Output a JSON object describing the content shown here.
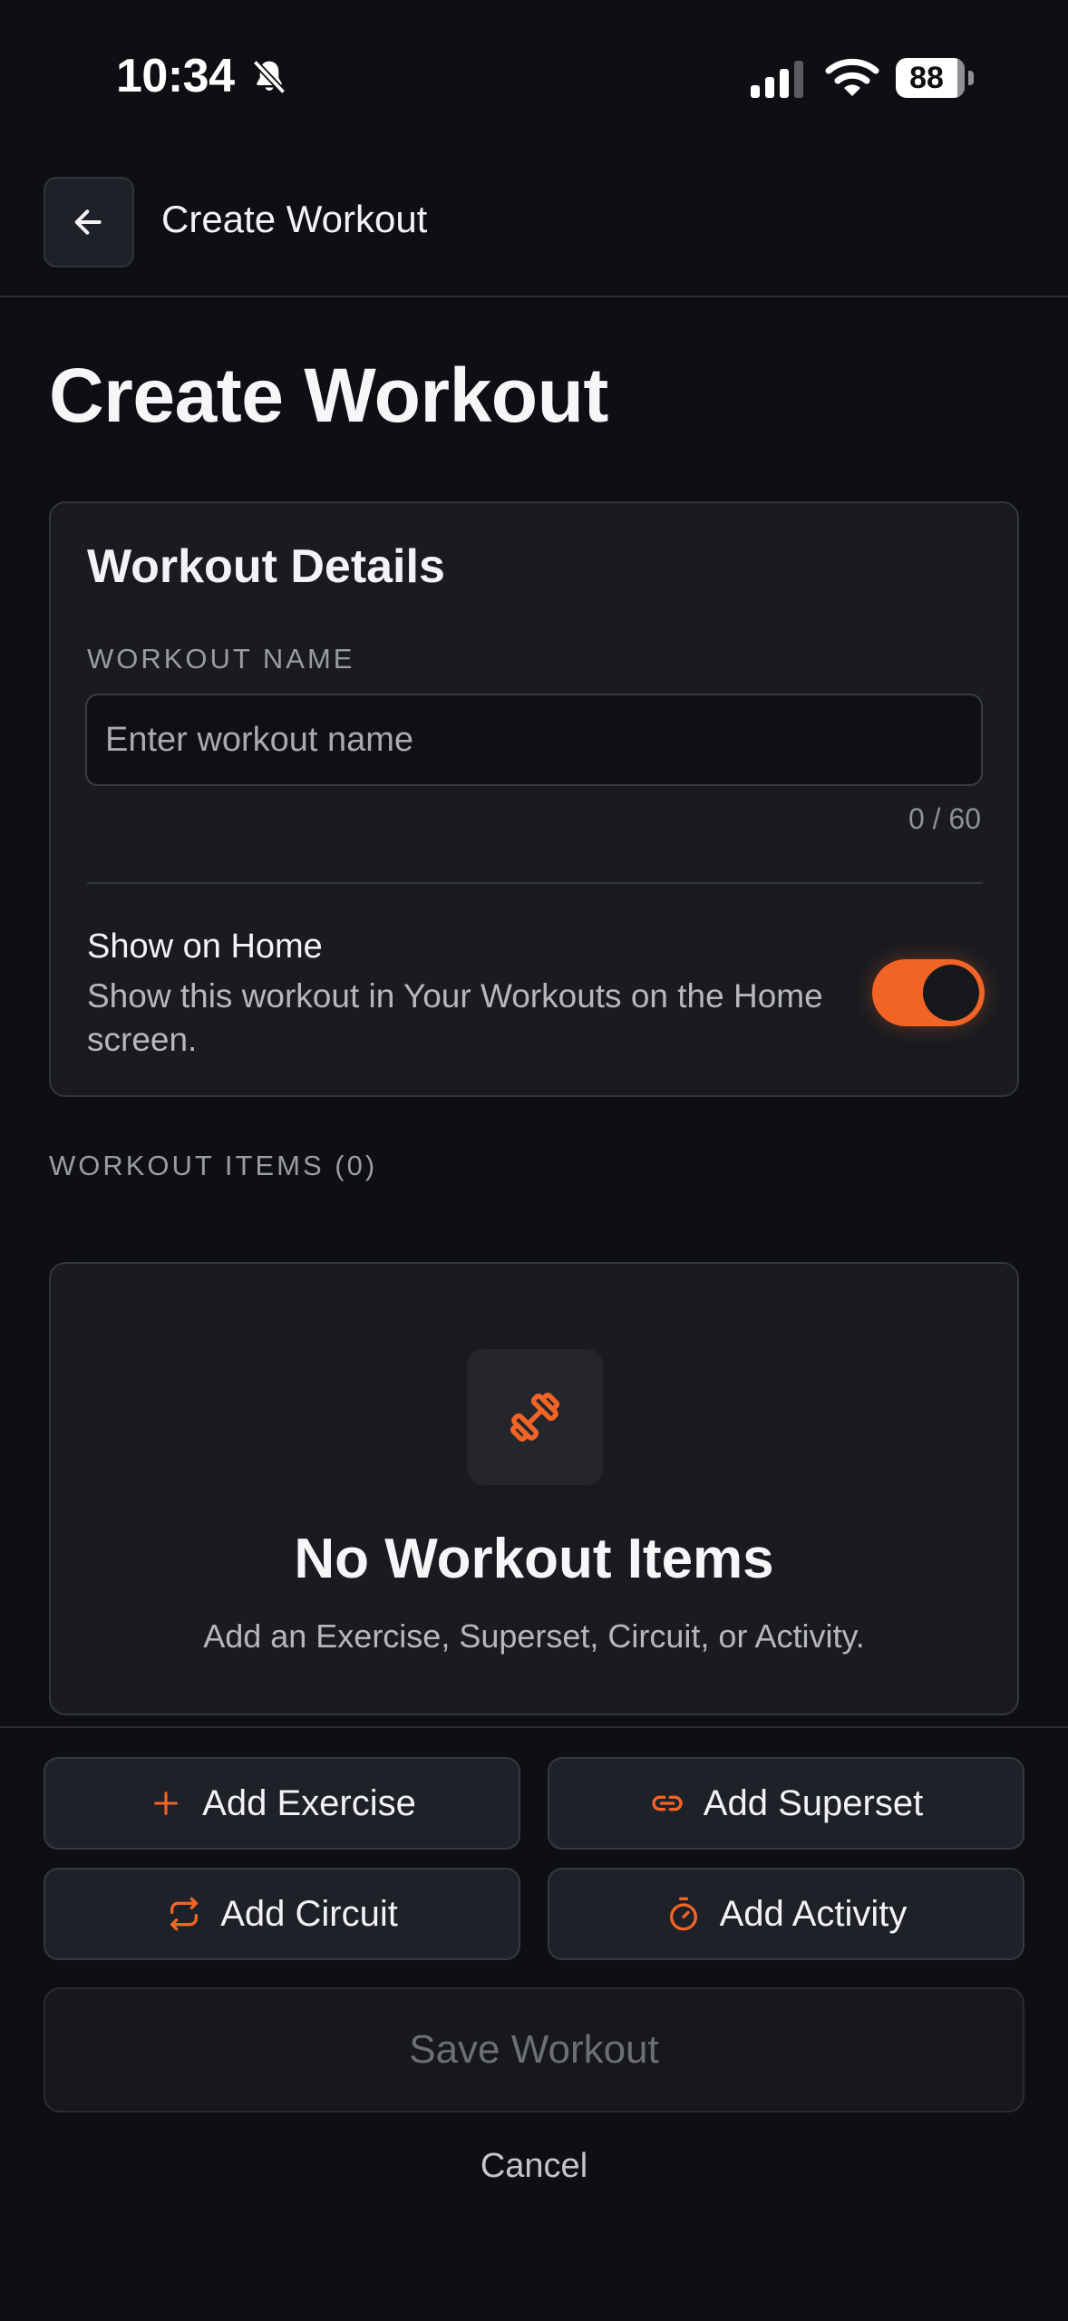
{
  "status_bar": {
    "time": "10:34",
    "battery": "88",
    "icons": [
      "bell-slash-icon",
      "cellular-signal-icon",
      "wifi-icon",
      "battery-icon"
    ]
  },
  "header": {
    "back_icon": "arrow-left-icon",
    "title": "Create Workout"
  },
  "page_title": "Create Workout",
  "details": {
    "card_title": "Workout Details",
    "name_label": "WORKOUT NAME",
    "name_value": "",
    "name_placeholder": "Enter workout name",
    "char_counter": "0 / 60",
    "show_on_home": {
      "title": "Show on Home",
      "description": "Show this workout in Your Workouts on the Home screen.",
      "enabled": true
    }
  },
  "items_section": {
    "label": "WORKOUT ITEMS (0)",
    "empty_icon": "dumbbell-icon",
    "empty_title": "No Workout Items",
    "empty_description": "Add an Exercise, Superset, Circuit, or Activity."
  },
  "actions": {
    "add_exercise": {
      "label": "Add Exercise",
      "icon": "plus-icon"
    },
    "add_superset": {
      "label": "Add Superset",
      "icon": "link-icon"
    },
    "add_circuit": {
      "label": "Add Circuit",
      "icon": "repeat-icon"
    },
    "add_activity": {
      "label": "Add Activity",
      "icon": "timer-icon"
    },
    "save": "Save Workout",
    "cancel": "Cancel"
  },
  "colors": {
    "background": "#0e0f12",
    "card": "#191b20",
    "accent": "#f26426",
    "text": "#f3f3f5",
    "muted": "#9a9ca3"
  }
}
